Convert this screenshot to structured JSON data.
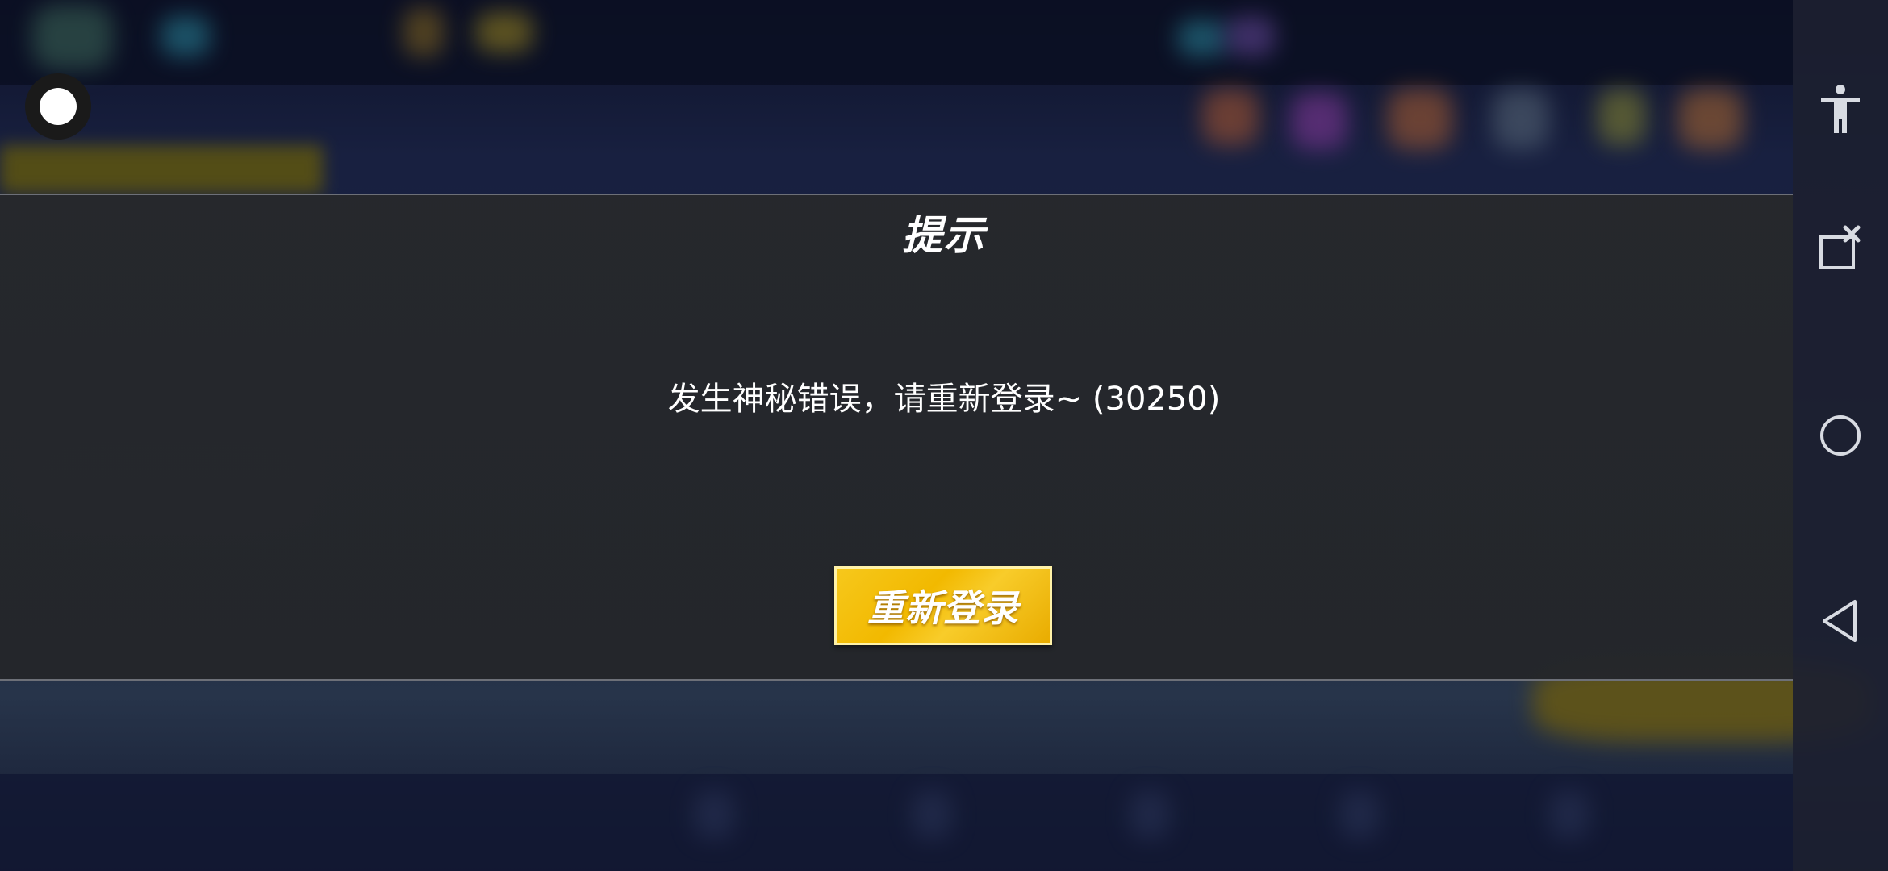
{
  "dialog": {
    "title": "提示",
    "message": "发生神秘错误，请重新登录~ (30250)",
    "relogin_label": "重新登录"
  },
  "system_nav": {
    "items": [
      "accessibility-icon",
      "close-app-icon",
      "home-icon",
      "back-icon"
    ]
  },
  "colors": {
    "button_yellow": "#f2b900",
    "modal_bg": "#26282c",
    "nav_icon": "#d8dbe2"
  }
}
